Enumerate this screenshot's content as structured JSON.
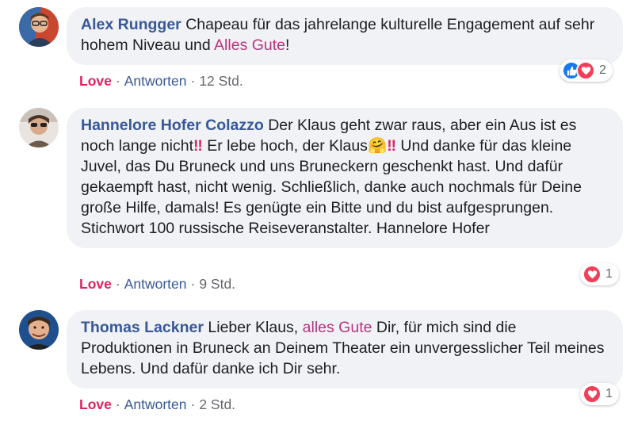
{
  "comments": [
    {
      "author": "Alex Rungger",
      "text_parts": [
        "Chapeau für das jahrelange kulturelle Engagement auf sehr hohem Niveau und ",
        "Alles Gute",
        "!"
      ],
      "love_label": "Love",
      "reply_label": "Antworten",
      "time": "12 Std.",
      "reaction_count": "2"
    },
    {
      "author": "Hannelore Hofer Colazzo",
      "text_parts": [
        "Der Klaus geht zwar raus, aber ein Aus ist es noch lange nicht",
        "‼",
        " Er lebe hoch, der Klaus",
        "🤗",
        "‼",
        " Und danke für das kleine Juvel, das Du Bruneck und uns Bruneckern geschenkt hast. Und dafür gekaempft hast, nicht wenig. Schließlich, danke auch nochmals für Deine große Hilfe, damals! Es genügte ein Bitte und du bist aufgesprungen. Stichwort 100 russische Reiseveranstalter. Hannelore Hofer"
      ],
      "love_label": "Love",
      "reply_label": "Antworten",
      "time": "9 Std.",
      "reaction_count": "1"
    },
    {
      "author": "Thomas Lackner",
      "text_parts": [
        "Lieber Klaus, ",
        "alles Gute",
        " Dir, für mich sind die Produktionen in Bruneck an Deinem Theater ein unvergesslicher Teil meines Lebens. Und dafür danke ich Dir sehr."
      ],
      "love_label": "Love",
      "reply_label": "Antworten",
      "time": "2 Std.",
      "reaction_count": "1"
    }
  ],
  "separator": "·",
  "icons": [
    "like-icon",
    "heart-icon"
  ],
  "colors": {
    "author": "#385898",
    "highlight": "#b7357f",
    "love": "#e0245e",
    "bubble": "#f0f2f5",
    "like": "#1877f2",
    "heart": "#f33e58"
  }
}
